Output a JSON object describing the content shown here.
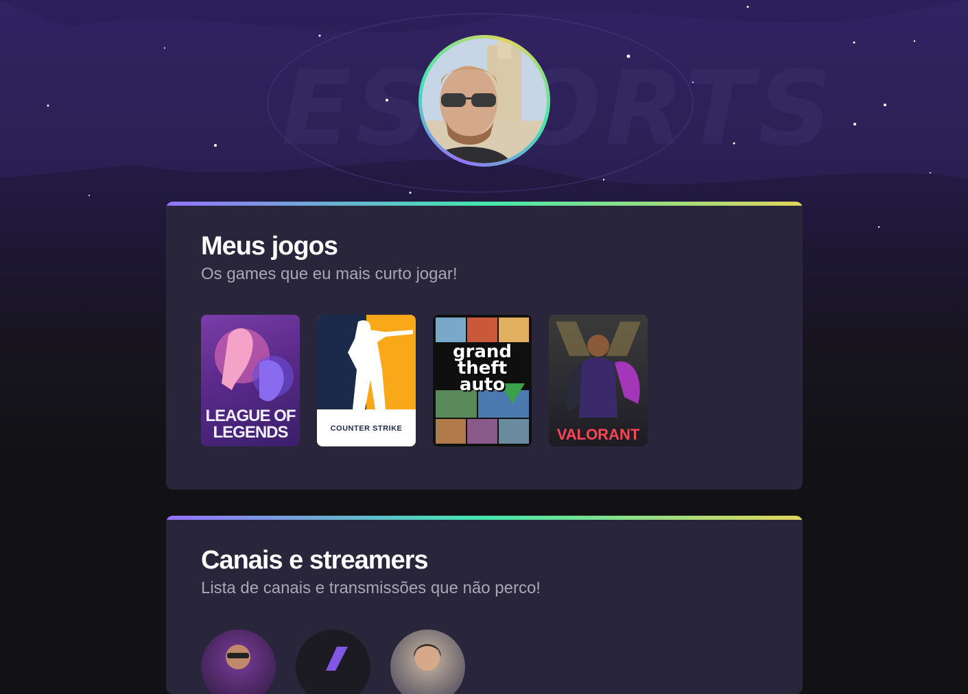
{
  "profile": {
    "avatar_alt": "Foto de perfil"
  },
  "games_section": {
    "title": "Meus jogos",
    "subtitle": "Os games que eu mais curto jogar!",
    "games": [
      {
        "label": "LEAGUE OF LEGENDS"
      },
      {
        "label": "COUNTER STRIKE"
      },
      {
        "label": "grand theft auto"
      },
      {
        "label": "VALORANT"
      }
    ]
  },
  "channels_section": {
    "title": "Canais e streamers",
    "subtitle": "Lista de canais e transmissões que não perco!"
  },
  "colors": {
    "accent_gradient": [
      "#9572fc",
      "#43e7ad",
      "#e2d45c"
    ],
    "card_bg": "#29253a",
    "page_bg": "#121214",
    "subtitle": "#a8a8b3",
    "valorant_red": "#ff4655"
  }
}
